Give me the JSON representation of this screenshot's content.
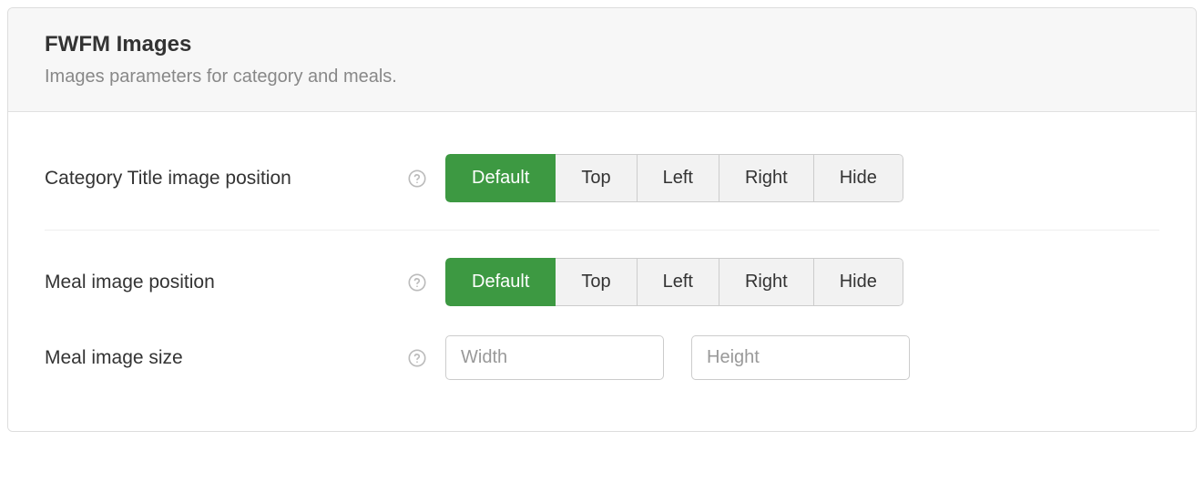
{
  "header": {
    "title": "FWFM Images",
    "subtitle": "Images parameters for category and meals."
  },
  "labels": {
    "categoryTitlePos": "Category Title image position",
    "mealImagePos": "Meal image position",
    "mealImageSize": "Meal image size"
  },
  "options": {
    "default": "Default",
    "top": "Top",
    "left": "Left",
    "right": "Right",
    "hide": "Hide"
  },
  "inputs": {
    "widthPlaceholder": "Width",
    "heightPlaceholder": "Height",
    "widthValue": "",
    "heightValue": ""
  },
  "selected": {
    "categoryTitlePos": "Default",
    "mealImagePos": "Default"
  }
}
